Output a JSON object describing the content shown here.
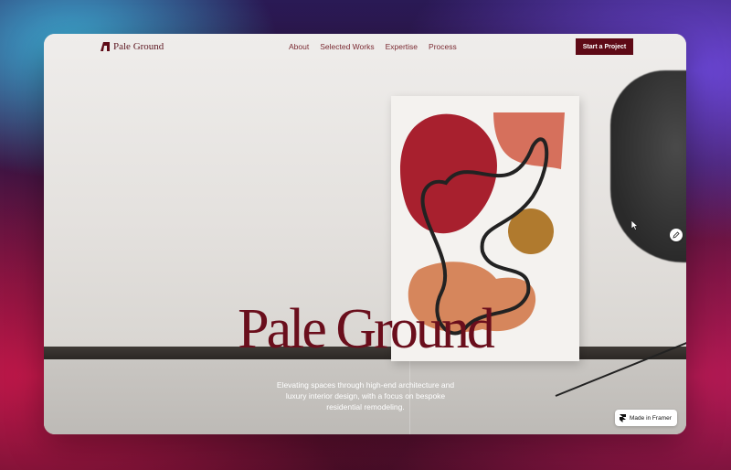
{
  "brand": {
    "name": "Pale Ground"
  },
  "nav": {
    "links": [
      "About",
      "Selected Works",
      "Expertise",
      "Process"
    ],
    "cta": "Start a Project"
  },
  "hero": {
    "title": "Pale Ground",
    "subtitle": "Elevating spaces through high-end architecture and luxury interior design, with a focus on bespoke residential remodeling."
  },
  "badge": {
    "label": "Made in Framer"
  },
  "colors": {
    "accent": "#5e0a16",
    "title": "#6a0e1c",
    "link": "#7a2a32"
  },
  "icons": {
    "logo": "pale-ground-logo-icon",
    "framer": "framer-logo-icon",
    "edit": "pencil-icon",
    "cursor": "mouse-pointer-icon"
  }
}
